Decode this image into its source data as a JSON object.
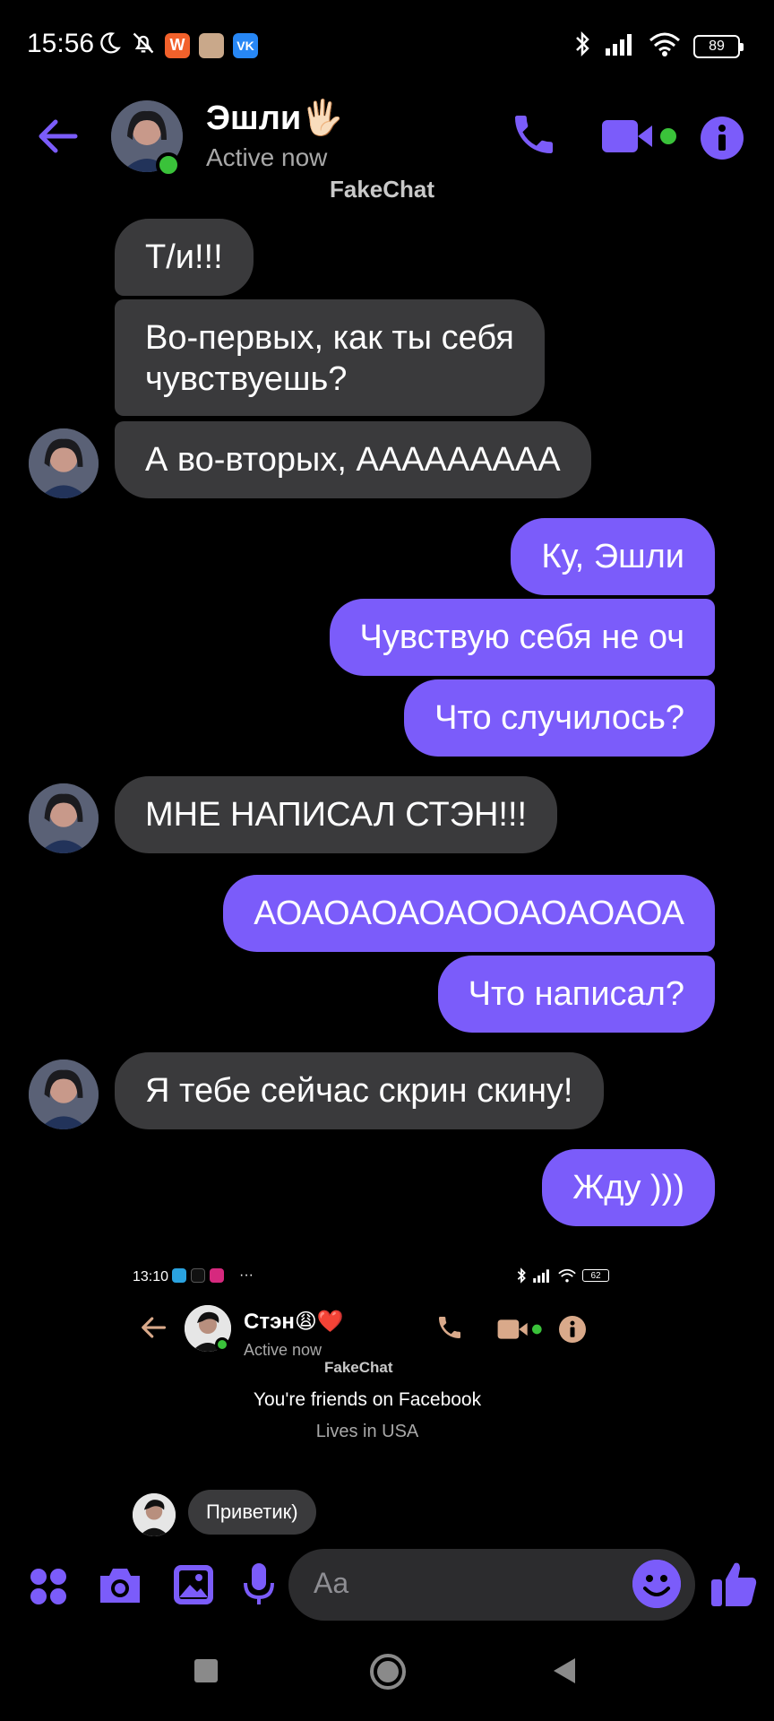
{
  "status_bar": {
    "time": "15:56",
    "battery": "89",
    "icons": [
      "moon-icon",
      "bell-off-icon",
      "app-w-icon",
      "app-badger-icon",
      "vk-icon",
      "bluetooth-icon",
      "signal-icon",
      "wifi-icon",
      "battery-icon"
    ]
  },
  "header": {
    "name": "Эшли🖐🏻",
    "status": "Active now",
    "watermark": "FakeChat",
    "accent": "#7b5cfa",
    "online_color": "#3ac23a"
  },
  "messages": [
    {
      "side": "in",
      "text": "Т/и!!!"
    },
    {
      "side": "in",
      "text": "Во-первых, как ты себя"
    },
    {
      "side": "in",
      "text": "чувствуешь?"
    },
    {
      "side": "in",
      "text": "А во-вторых, ААААААААА"
    },
    {
      "side": "out",
      "text": "Ку, Эшли"
    },
    {
      "side": "out",
      "text": "Чувствую себя не оч"
    },
    {
      "side": "out",
      "text": "Что случилось?"
    },
    {
      "side": "in",
      "text": "МНЕ НАПИСАЛ СТЭН!!!"
    },
    {
      "side": "out",
      "text": "АОАОАОАОАООАОАОАОА"
    },
    {
      "side": "out",
      "text": "Что написал?"
    },
    {
      "side": "in",
      "text": "Я тебе сейчас скрин скину!"
    },
    {
      "side": "out",
      "text": "Жду )))"
    }
  ],
  "shared_screenshot": {
    "time": "13:10",
    "battery": "62",
    "ellipsis": "···",
    "name": "Стэн😩❤️",
    "status": "Active now",
    "watermark": "FakeChat",
    "friends_text": "You're friends on Facebook",
    "lives_text": "Lives in USA",
    "message": "Приветик)"
  },
  "composer": {
    "placeholder": "Aa",
    "icons": [
      "apps-icon",
      "camera-icon",
      "image-icon",
      "mic-icon",
      "emoji-icon",
      "thumbs-up-icon"
    ]
  },
  "colors": {
    "bubble_in": "#3a3a3c",
    "bubble_out": "#7b5cfa",
    "background": "#000000"
  }
}
